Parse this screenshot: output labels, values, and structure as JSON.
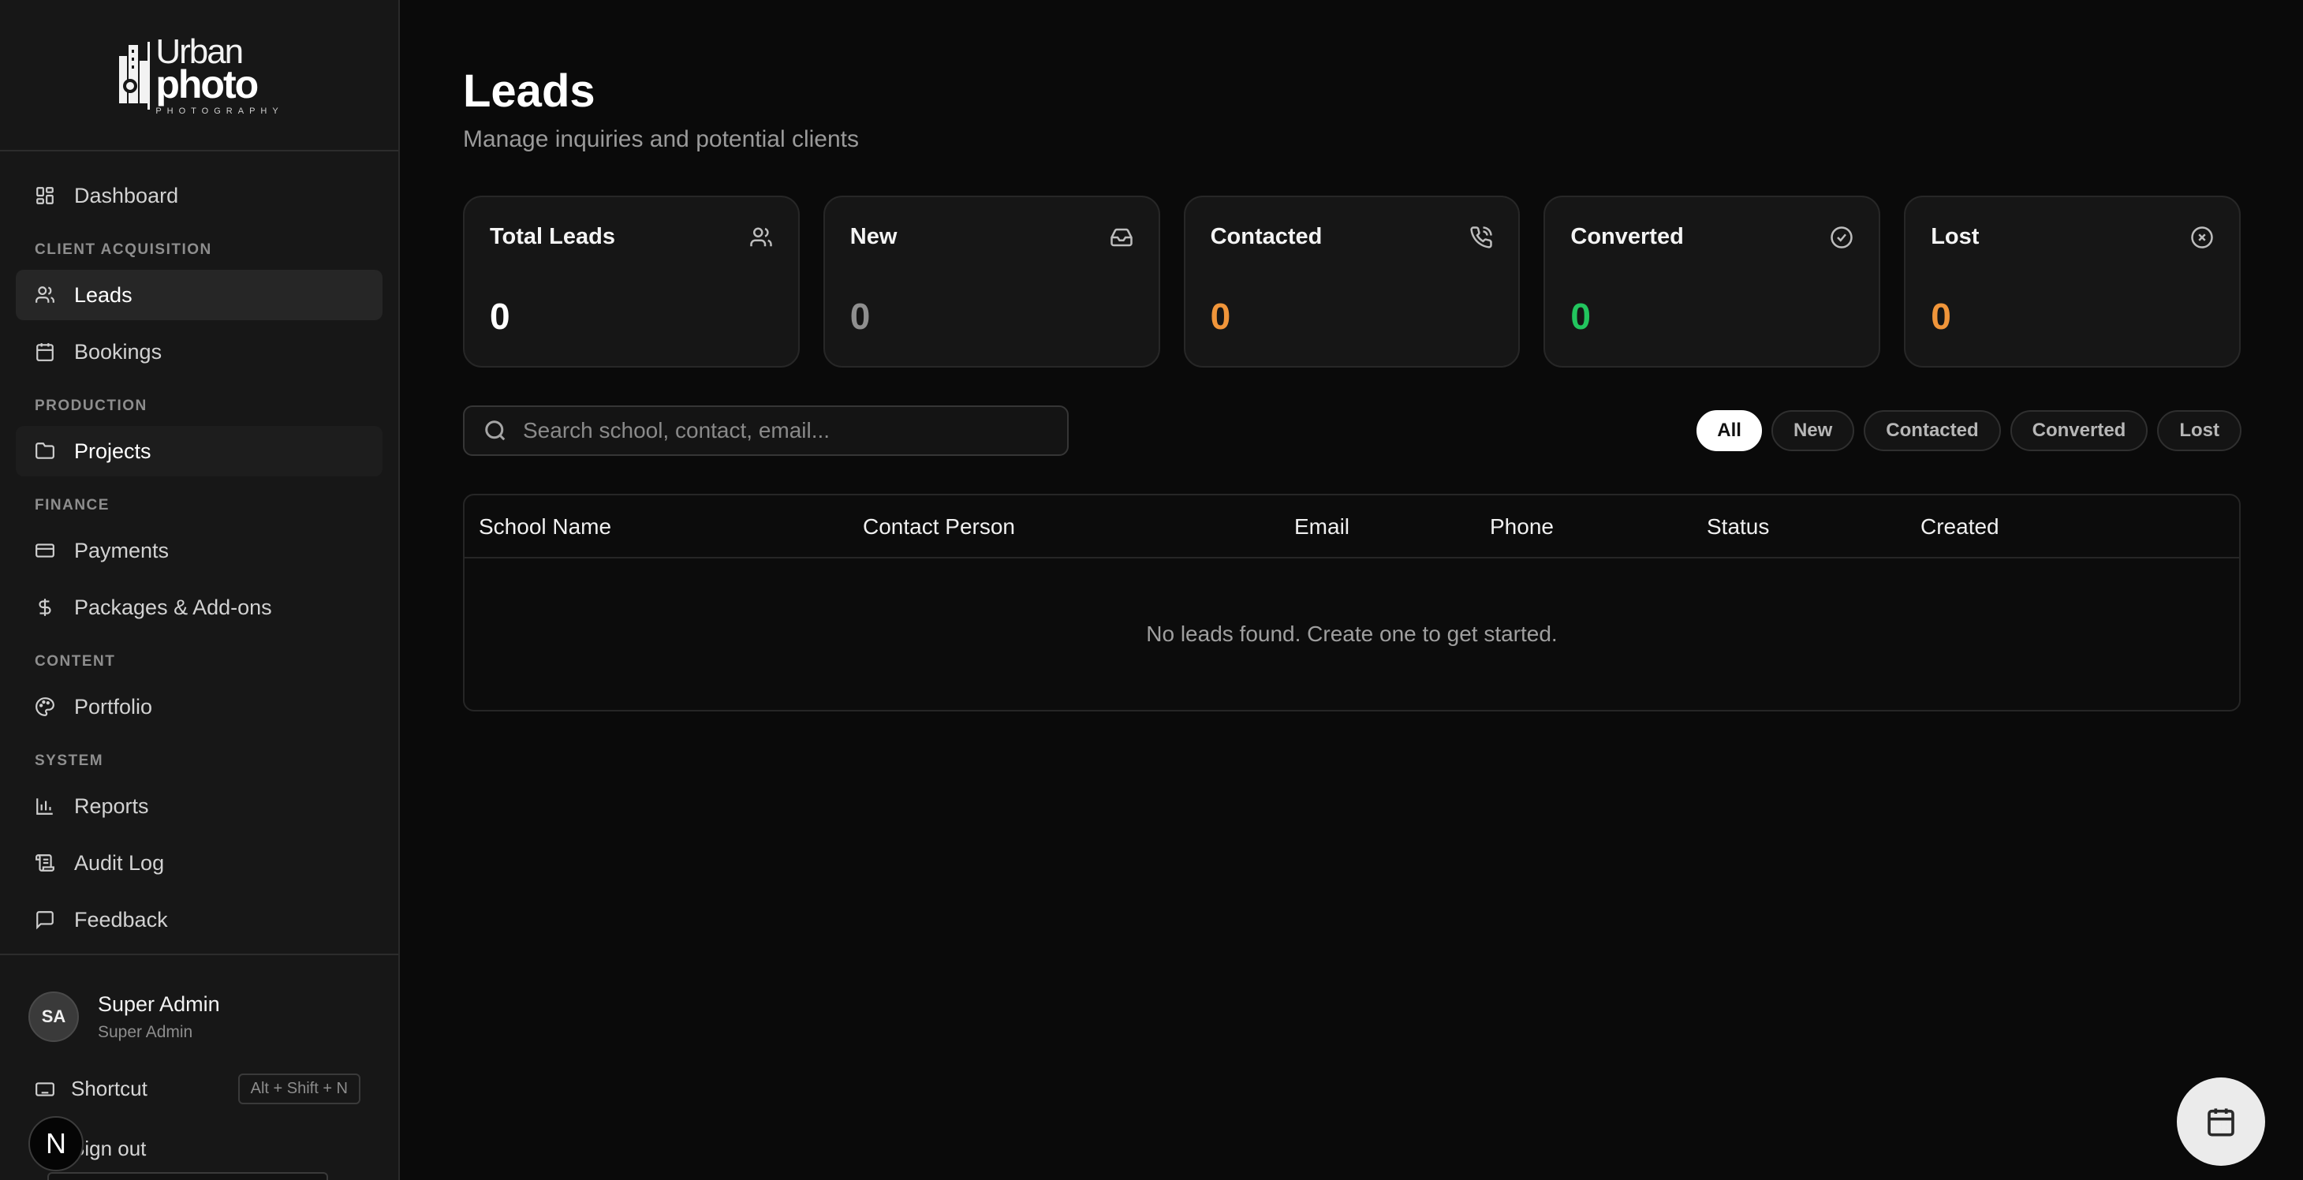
{
  "brand": {
    "line1": "Urban",
    "line2": "photo",
    "line3": "PHOTOGRAPHY"
  },
  "sidebar": {
    "top_item": {
      "label": "Dashboard",
      "icon": "grid-icon"
    },
    "sections": [
      {
        "title": "CLIENT ACQUISITION",
        "items": [
          {
            "label": "Leads",
            "icon": "users-icon"
          },
          {
            "label": "Bookings",
            "icon": "calendar-icon"
          }
        ]
      },
      {
        "title": "PRODUCTION",
        "items": [
          {
            "label": "Projects",
            "icon": "folder-icon"
          }
        ]
      },
      {
        "title": "FINANCE",
        "items": [
          {
            "label": "Payments",
            "icon": "credit-card-icon"
          },
          {
            "label": "Packages & Add-ons",
            "icon": "dollar-icon"
          }
        ]
      },
      {
        "title": "CONTENT",
        "items": [
          {
            "label": "Portfolio",
            "icon": "palette-icon"
          }
        ]
      },
      {
        "title": "SYSTEM",
        "items": [
          {
            "label": "Reports",
            "icon": "bar-chart-icon"
          },
          {
            "label": "Audit Log",
            "icon": "scroll-icon"
          },
          {
            "label": "Feedback",
            "icon": "message-icon"
          }
        ]
      }
    ],
    "active_item": "Leads"
  },
  "user": {
    "initials": "SA",
    "name": "Super Admin",
    "role": "Super Admin"
  },
  "footer": {
    "shortcut_label": "Shortcut",
    "shortcut_keys": "Alt + Shift + N",
    "signout_label": "Sign out",
    "next_badge": "N"
  },
  "page": {
    "title": "Leads",
    "subtitle": "Manage inquiries and potential clients"
  },
  "stats": [
    {
      "label": "Total Leads",
      "value": "0",
      "icon": "users-icon",
      "color": "#ffffff"
    },
    {
      "label": "New",
      "value": "0",
      "icon": "inbox-icon",
      "color": "#8f8f8f"
    },
    {
      "label": "Contacted",
      "value": "0",
      "icon": "phone-call-icon",
      "color": "#f0953a"
    },
    {
      "label": "Converted",
      "value": "0",
      "icon": "check-circle-icon",
      "color": "#22c55e"
    },
    {
      "label": "Lost",
      "value": "0",
      "icon": "x-circle-icon",
      "color": "#f0953a"
    }
  ],
  "search": {
    "placeholder": "Search school, contact, email..."
  },
  "filters": [
    "All",
    "New",
    "Contacted",
    "Converted",
    "Lost"
  ],
  "active_filter": "All",
  "table": {
    "columns": [
      "School Name",
      "Contact Person",
      "Email",
      "Phone",
      "Status",
      "Created"
    ],
    "empty_message": "No leads found. Create one to get started."
  },
  "fab": {
    "icon": "calendar-icon"
  }
}
